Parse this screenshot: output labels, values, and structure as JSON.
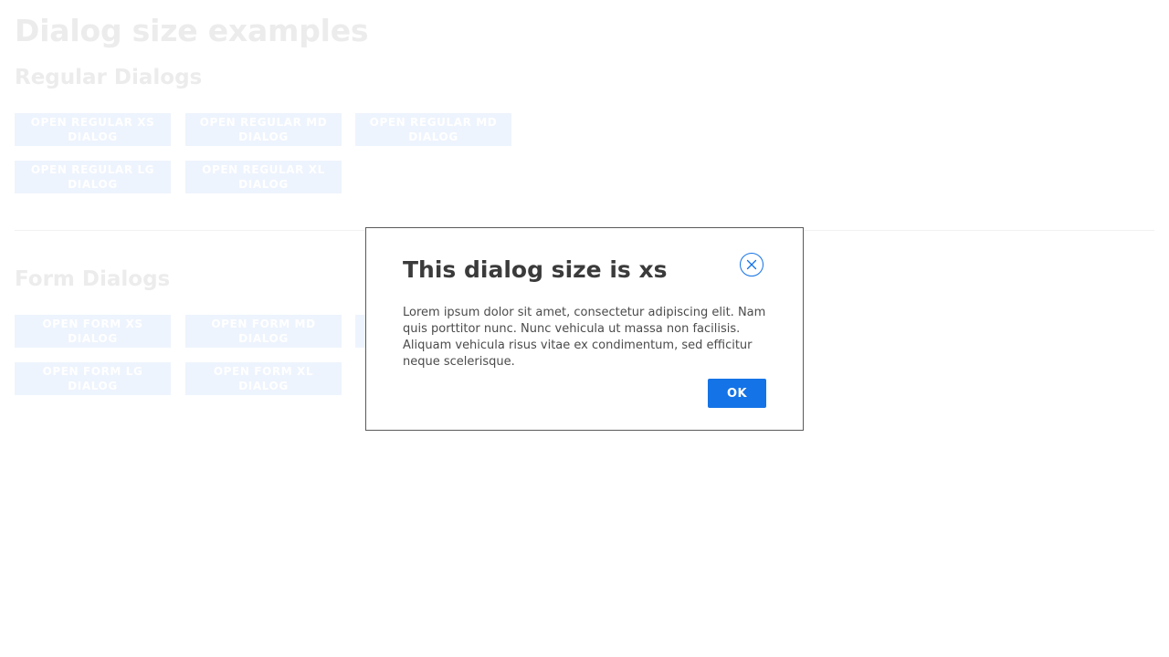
{
  "page": {
    "title": "Dialog size examples"
  },
  "regular": {
    "heading": "Regular Dialogs",
    "buttons": [
      "OPEN REGULAR XS DIALOG",
      "OPEN REGULAR MD DIALOG",
      "OPEN REGULAR MD DIALOG",
      "OPEN REGULAR LG DIALOG",
      "OPEN REGULAR XL DIALOG"
    ]
  },
  "form": {
    "heading": "Form Dialogs",
    "buttons": [
      "OPEN FORM XS DIALOG",
      "OPEN FORM MD DIALOG",
      "OPEN FORM LG DIALOG",
      "OPEN FORM XL DIALOG"
    ]
  },
  "dialog": {
    "title": "This dialog size is xs",
    "body": "Lorem ipsum dolor sit amet, consectetur adipiscing elit. Nam quis porttitor nunc. Nunc vehicula ut massa non facilisis. Aliquam vehicula risus vitae ex condimentum, sed efficitur neque scelerisque.",
    "ok_label": "OK",
    "close_icon": "close-circle-icon"
  },
  "colors": {
    "accent": "#1473e6",
    "faded_button_bg": "#eef4fd",
    "faded_heading": "#ececec",
    "dialog_border": "#5a5a5a"
  }
}
